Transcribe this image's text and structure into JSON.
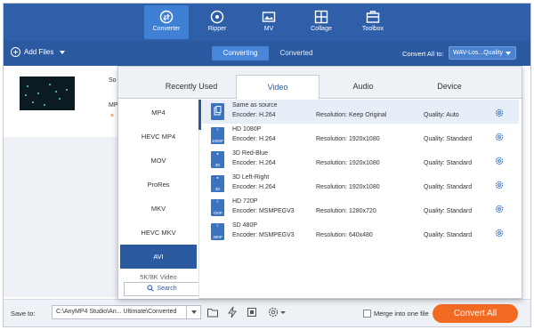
{
  "nav": {
    "items": [
      {
        "label": "Converter",
        "icon": "converter-icon"
      },
      {
        "label": "Ripper",
        "icon": "ripper-icon"
      },
      {
        "label": "MV",
        "icon": "mv-icon"
      },
      {
        "label": "Collage",
        "icon": "collage-icon"
      },
      {
        "label": "Toolbox",
        "icon": "toolbox-icon"
      }
    ],
    "active": "Converter"
  },
  "toolbar": {
    "add_files": "Add Files",
    "tab_converting": "Converting",
    "tab_converted": "Converted",
    "convert_all_label": "Convert All to:",
    "convert_all_value": "WAV-Los...Quality"
  },
  "file_list": {
    "name_fragment": "So",
    "format_fragment": "MP"
  },
  "popup": {
    "tabs": [
      "Recently Used",
      "Video",
      "Audio",
      "Device"
    ],
    "active_tab": "Video",
    "formats": [
      "MP4",
      "HEVC MP4",
      "MOV",
      "ProRes",
      "MKV",
      "HEVC MKV",
      "AVI",
      "5K/8K Video"
    ],
    "active_format": "AVI",
    "search_label": "Search",
    "presets": [
      {
        "name": "Same as source",
        "encoder": "Encoder: H.264",
        "resolution": "Resolution: Keep Original",
        "quality": "Quality: Auto",
        "badge": ""
      },
      {
        "name": "HD 1080P",
        "encoder": "Encoder: H.264",
        "resolution": "Resolution: 1920x1080",
        "quality": "Quality: Standard",
        "badge": "1080P"
      },
      {
        "name": "3D Red-Blue",
        "encoder": "Encoder: H.264",
        "resolution": "Resolution: 1920x1080",
        "quality": "Quality: Standard",
        "badge": "3D"
      },
      {
        "name": "3D Left-Right",
        "encoder": "Encoder: H.264",
        "resolution": "Resolution: 1920x1080",
        "quality": "Quality: Standard",
        "badge": "3D"
      },
      {
        "name": "HD 720P",
        "encoder": "Encoder: MSMPEGV3",
        "resolution": "Resolution: 1280x720",
        "quality": "Quality: Standard",
        "badge": "720P"
      },
      {
        "name": "SD 480P",
        "encoder": "Encoder: MSMPEGV3",
        "resolution": "Resolution: 640x480",
        "quality": "Quality: Standard",
        "badge": "480P"
      }
    ]
  },
  "bottom": {
    "save_to_label": "Save to:",
    "save_path": "C:\\AnyMP4 Studio\\An... Ultimate\\Converted",
    "merge_label": "Merge into one file",
    "merge_checked": false,
    "convert_all_button": "Convert All"
  },
  "colors": {
    "nav_bg": "#2e5fa8",
    "accent": "#2c5aa0",
    "convert_button": "#f26a22"
  }
}
